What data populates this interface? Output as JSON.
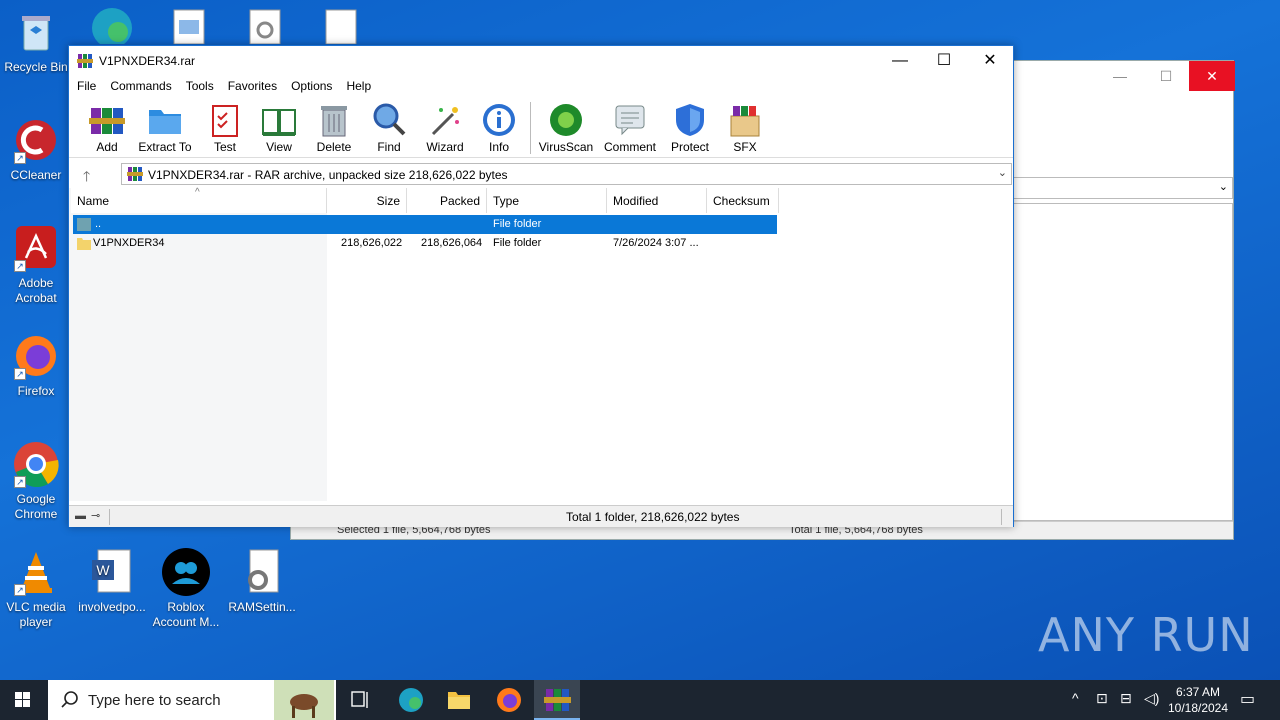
{
  "desktop": {
    "icons": [
      {
        "label": "Recycle Bin"
      },
      {
        "label": "CCleaner"
      },
      {
        "label": "Adobe Acrobat"
      },
      {
        "label": "Firefox"
      },
      {
        "label": "Google Chrome"
      },
      {
        "label": "VLC media player"
      },
      {
        "label": "involvedpo..."
      },
      {
        "label": "Roblox Account M..."
      },
      {
        "label": "RAMSettin..."
      }
    ]
  },
  "back_window": {
    "status_left": "Selected 1 file, 5,664,768 bytes",
    "status_right": "Total 1 file, 5,664,768 bytes"
  },
  "window": {
    "title": "V1PNXDER34.rar",
    "menu": [
      "File",
      "Commands",
      "Tools",
      "Favorites",
      "Options",
      "Help"
    ],
    "toolbar": [
      "Add",
      "Extract To",
      "Test",
      "View",
      "Delete",
      "Find",
      "Wizard",
      "Info",
      "VirusScan",
      "Comment",
      "Protect",
      "SFX"
    ],
    "path": "V1PNXDER34.rar - RAR archive, unpacked size 218,626,022 bytes",
    "columns": [
      "Name",
      "Size",
      "Packed",
      "Type",
      "Modified",
      "Checksum"
    ],
    "rows": [
      {
        "name": "..",
        "size": "",
        "packed": "",
        "type": "File folder",
        "modified": "",
        "checksum": ""
      },
      {
        "name": "V1PNXDER34",
        "size": "218,626,022",
        "packed": "218,626,064",
        "type": "File folder",
        "modified": "7/26/2024 3:07 ...",
        "checksum": ""
      }
    ],
    "status": "Total 1 folder, 218,626,022 bytes"
  },
  "taskbar": {
    "search_placeholder": "Type here to search",
    "time": "6:37 AM",
    "date": "10/18/2024"
  },
  "watermark": "ANY RUN"
}
